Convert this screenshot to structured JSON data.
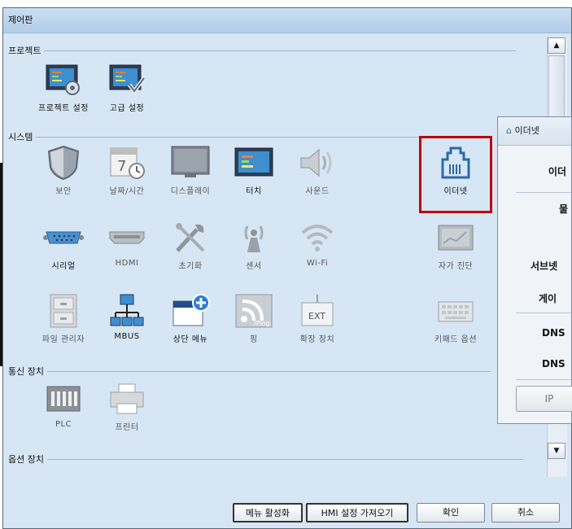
{
  "window": {
    "title": "제어판"
  },
  "sections": {
    "project": "프로젝트",
    "system": "시스템",
    "comm": "통신 장치",
    "options": "옵션 장치"
  },
  "project_items": [
    {
      "label": "프로젝트 설정",
      "icon": "project-settings-icon"
    },
    {
      "label": "고급 설정",
      "icon": "advanced-settings-icon"
    }
  ],
  "system_items": [
    {
      "label": "보안",
      "icon": "shield-icon"
    },
    {
      "label": "날짜/시간",
      "icon": "calendar-clock-icon"
    },
    {
      "label": "디스플레이",
      "icon": "monitor-icon"
    },
    {
      "label": "터치",
      "icon": "touch-screen-icon"
    },
    {
      "label": "사운드",
      "icon": "speaker-icon"
    },
    {
      "label": "이더넷",
      "icon": "ethernet-port-icon"
    },
    {
      "label": "시리얼",
      "icon": "serial-port-icon"
    },
    {
      "label": "HDMI",
      "icon": "hdmi-icon"
    },
    {
      "label": "초기화",
      "icon": "tools-icon"
    },
    {
      "label": "센서",
      "icon": "sensor-icon"
    },
    {
      "label": "Wi-Fi",
      "icon": "wifi-icon"
    },
    {
      "label": "자가 진단",
      "icon": "diagnostics-icon"
    },
    {
      "label": "파일 관리자",
      "icon": "file-cabinet-icon"
    },
    {
      "label": "MBUS",
      "icon": "network-tree-icon"
    },
    {
      "label": "상단 메뉴",
      "icon": "add-menu-icon"
    },
    {
      "label": "핑",
      "icon": "ping-icon"
    },
    {
      "label": "확장 장치",
      "icon": "ext-device-icon"
    },
    {
      "label": "키패드 옵션",
      "icon": "keypad-icon"
    }
  ],
  "comm_items": [
    {
      "label": "PLC",
      "icon": "plc-icon"
    },
    {
      "label": "프린터",
      "icon": "printer-icon"
    }
  ],
  "ping_badge": "/Ping",
  "ext_badge": "EXT",
  "buttons": {
    "enable_menu": "메뉴 활성화",
    "import_hmi": "HMI 설정 가져오기",
    "ok": "확인",
    "cancel": "취소"
  },
  "popup": {
    "title": "이더넷",
    "rows": [
      "이더",
      "물",
      "서브넷",
      "게이",
      "DNS",
      "DNS"
    ],
    "button": "IP"
  },
  "colors": {
    "selection": "#c00000",
    "panel_bg": "#d7e6f5"
  }
}
